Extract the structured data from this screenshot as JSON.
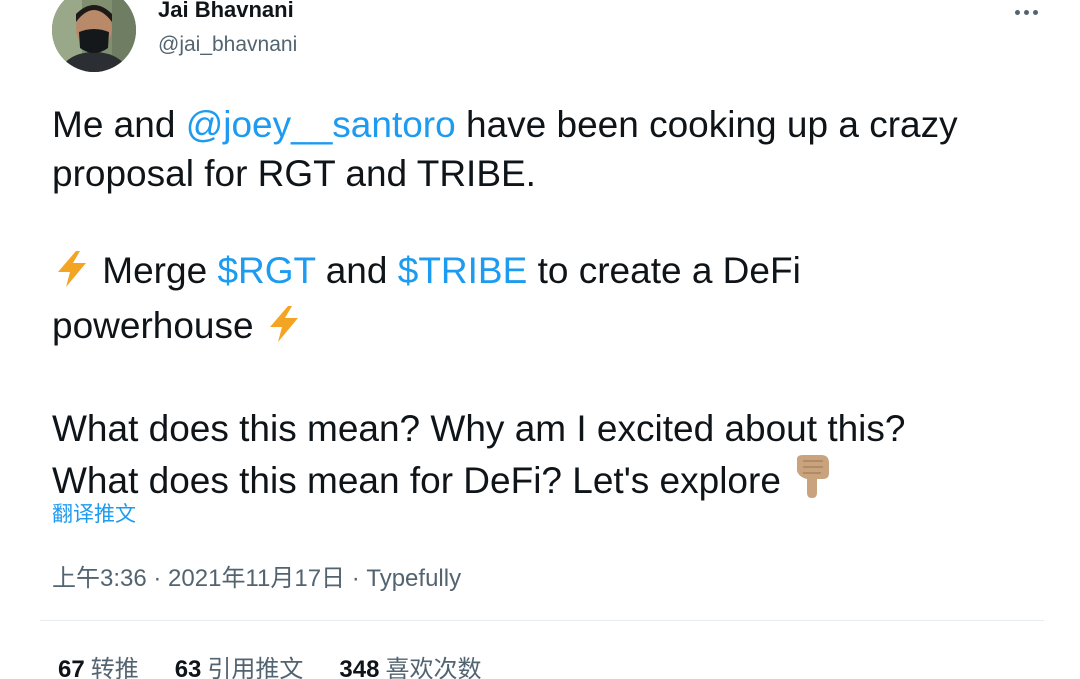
{
  "author": {
    "name": "Jai Bhavnani",
    "handle": "@jai_bhavnani"
  },
  "tweet": {
    "line1_pre": "Me and ",
    "mention": "@joey__santoro",
    "line1_post": " have been cooking up a crazy",
    "line2": "proposal for RGT and TRIBE.",
    "line3_pre": " Merge ",
    "cashtag_rgt": "$RGT",
    "line3_mid": " and ",
    "cashtag_tribe": "$TRIBE",
    "line3_post": " to create a DeFi",
    "line4": "powerhouse ",
    "line5": "What does this mean? Why am I excited about this?",
    "line6": "What does this mean for DeFi? Let's explore "
  },
  "translate_label": "翻译推文",
  "meta": {
    "time": "上午3:36",
    "sep1": " · ",
    "date": "2021年11月17日",
    "sep2": " · ",
    "source": "Typefully"
  },
  "stats": {
    "retweets_count": "67",
    "retweets_label": "转推",
    "quotes_count": "63",
    "quotes_label": "引用推文",
    "likes_count": "348",
    "likes_label": "喜欢次数"
  },
  "colors": {
    "link": "#1d9bf0",
    "text": "#0f1419",
    "secondary": "#536471",
    "lightning": "#f4a423",
    "pointing_hand": "#c9a27e"
  },
  "icons": [
    "more-icon",
    "lightning-icon",
    "pointing-down-icon"
  ]
}
